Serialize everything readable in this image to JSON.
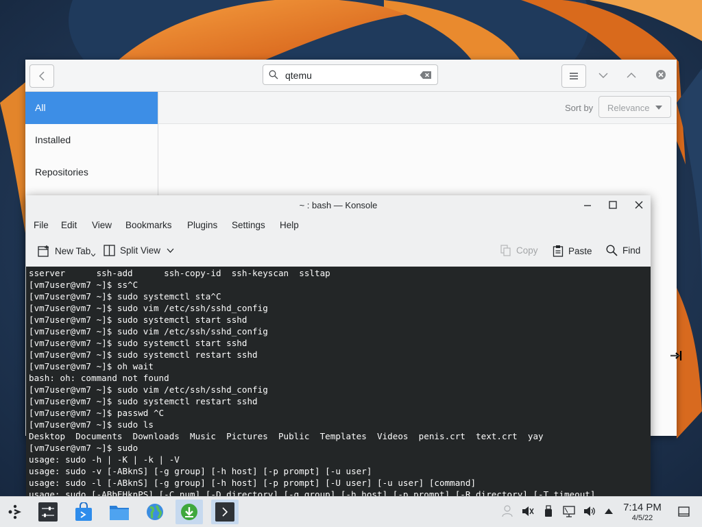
{
  "discover": {
    "search": {
      "value": "qtemu"
    },
    "nav": [
      "All",
      "Installed",
      "Repositories"
    ],
    "sort_label": "Sort by",
    "sort_value": "Relevance"
  },
  "konsole": {
    "title": "~ : bash — Konsole",
    "menu": [
      "File",
      "Edit",
      "View",
      "Bookmarks",
      "Plugins",
      "Settings",
      "Help"
    ],
    "toolbar": {
      "new_tab": "New Tab",
      "split_view": "Split View",
      "copy": "Copy",
      "paste": "Paste",
      "find": "Find"
    },
    "terminal_lines": [
      "sserver      ssh-add      ssh-copy-id  ssh-keyscan  ssltap",
      "[vm7user@vm7 ~]$ ss^C",
      "[vm7user@vm7 ~]$ sudo systemctl sta^C",
      "[vm7user@vm7 ~]$ sudo vim /etc/ssh/sshd_config",
      "[vm7user@vm7 ~]$ sudo systemctl start sshd",
      "[vm7user@vm7 ~]$ sudo vim /etc/ssh/sshd_config",
      "[vm7user@vm7 ~]$ sudo systemctl start sshd",
      "[vm7user@vm7 ~]$ sudo systemctl restart sshd",
      "[vm7user@vm7 ~]$ oh wait",
      "bash: oh: command not found",
      "[vm7user@vm7 ~]$ sudo vim /etc/ssh/sshd_config",
      "[vm7user@vm7 ~]$ sudo systemctl restart sshd",
      "[vm7user@vm7 ~]$ passwd ^C",
      "[vm7user@vm7 ~]$ sudo ls",
      "Desktop  Documents  Downloads  Music  Pictures  Public  Templates  Videos  penis.crt  text.crt  yay",
      "[vm7user@vm7 ~]$ sudo",
      "usage: sudo -h | -K | -k | -V",
      "usage: sudo -v [-ABknS] [-g group] [-h host] [-p prompt] [-u user]",
      "usage: sudo -l [-ABknS] [-g group] [-h host] [-p prompt] [-U user] [-u user] [command]",
      "usage: sudo [-ABbEHknPS] [-C num] [-D directory] [-g group] [-h host] [-p prompt] [-R directory] [-T timeout]"
    ]
  },
  "taskbar": {
    "time": "7:14 PM",
    "date": "4/5/22"
  },
  "colors": {
    "accent": "#3d8ee6",
    "terminal_bg": "#232627",
    "terminal_fg": "#fcfcfc",
    "taskbar_bg": "#e8eaec"
  }
}
